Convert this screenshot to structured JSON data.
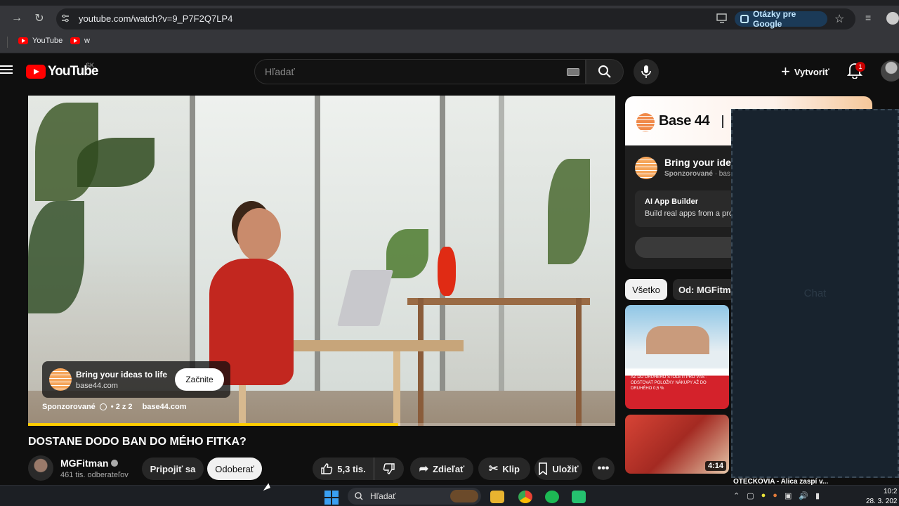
{
  "browser": {
    "url": "youtube.com/watch?v=9_P7F2Q7LP4",
    "google_pill": "Otázky pre Google",
    "bookmarks": [
      {
        "label": "YouTube"
      },
      {
        "label": "w"
      }
    ]
  },
  "header": {
    "logo_text": "YouTube",
    "country": "SK",
    "search_placeholder": "Hľadať",
    "create_label": "Vytvoriť",
    "notification_count": "1"
  },
  "player": {
    "ad": {
      "title": "Bring your ideas to life",
      "domain": "base44.com",
      "cta": "Začnite",
      "sponsored": "Sponzorované",
      "count": "• 2 z 2",
      "site": "base44.com"
    },
    "progress_fraction": 0.63,
    "progress_color": "#ffcc00"
  },
  "video": {
    "title": "DOSTANE DODO BAN DO MÉHO FITKA?",
    "channel_name": "MGFitman",
    "subscribers": "461 tis. odberateľov",
    "join_label": "Pripojiť sa",
    "subscribe_label": "Odoberať",
    "likes": "5,3 tis.",
    "share_label": "Zdieľať",
    "clip_label": "Klip",
    "save_label": "Uložiť"
  },
  "sidebar": {
    "ad": {
      "brand": "Base 44",
      "title": "Bring your ideas",
      "sponsored": "Sponzorované",
      "sponsored_suffix": "· bas",
      "card_title": "AI App Builder",
      "card_desc": "Build real apps from a pro"
    },
    "chips": [
      {
        "label": "Všetko"
      },
      {
        "label": "Od: MGFitman"
      }
    ],
    "thumbnails": [
      {
        "overlay_text": "AŽ DO DRUHÉHO STOLETÍ PRO VÁS · ODSTOVAT POLOŽKY NÁKUPY AŽ DO DRUHÉHO 0,5 %"
      },
      {
        "duration": "4:14"
      }
    ]
  },
  "chat": {
    "label": "Chat",
    "partial_text": "OTECKOVIA - Alica zaspí v..."
  },
  "taskbar": {
    "search_label": "Hľadať",
    "time": "10:2",
    "date": "28. 3. 202"
  },
  "colors": {
    "brand_red": "#ff0000",
    "accent_blue": "#3ea6ff",
    "background": "#0f0f0f"
  }
}
